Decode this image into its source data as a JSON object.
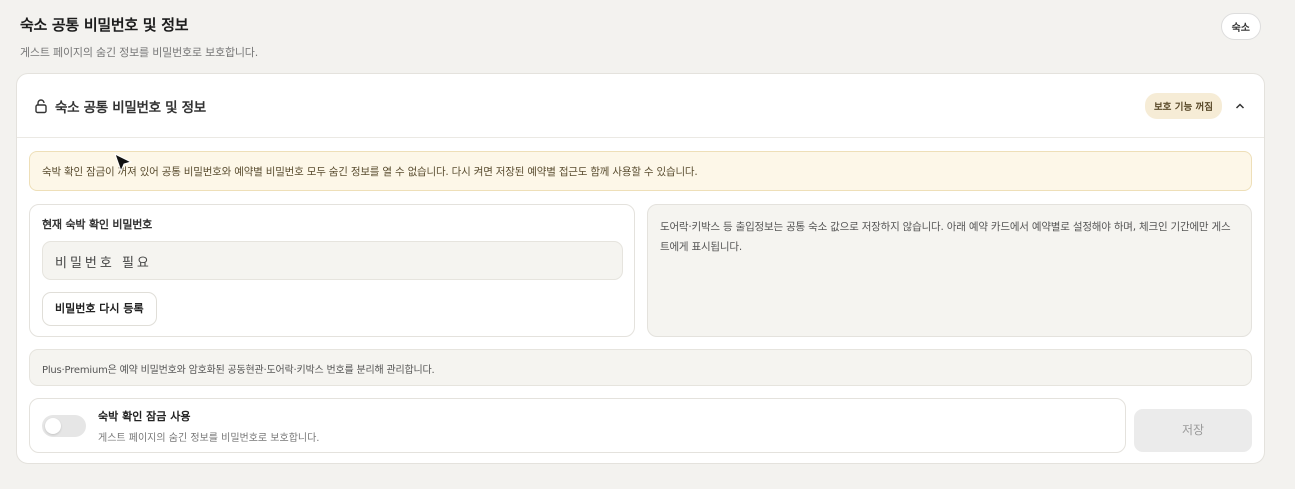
{
  "header": {
    "title": "숙소 공통 비밀번호 및 정보",
    "subtitle": "게스트 페이지의 숨긴 정보를 비밀번호로 보호합니다.",
    "badge": "숙소"
  },
  "card": {
    "title": "숙소 공통 비밀번호 및 정보",
    "status": "보호 기능 꺼짐",
    "notice": "숙박 확인 잠금이 꺼져 있어 공통 비밀번호와 예약별 비밀번호 모두 숨긴 정보를 열 수 없습니다. 다시 켜면 저장된 예약별 접근도 함께 사용할 수 있습니다.",
    "password": {
      "label": "현재 숙박 확인 비밀번호",
      "placeholder": "비밀번호 필요",
      "reset_button": "비밀번호 다시 등록"
    },
    "info_text": "도어락·키박스 등 출입정보는 공통 숙소 값으로 저장하지 않습니다. 아래 예약 카드에서 예약별로 설정해야 하며, 체크인 기간에만 게스트에게 표시됩니다.",
    "premium_note": "Plus·Premium은 예약 비밀번호와 암호화된 공동현관·도어락·키박스 번호를 분리해 관리합니다.",
    "toggle": {
      "title": "숙박 확인 잠금 사용",
      "subtitle": "게스트 페이지의 숨긴 정보를 비밀번호로 보호합니다.",
      "enabled": false
    },
    "save_button": "저장"
  },
  "colors": {
    "accent_pill": "#f6ecd6",
    "notice_bg": "#fdf7e8",
    "disabled_button": "#ebebeb"
  }
}
